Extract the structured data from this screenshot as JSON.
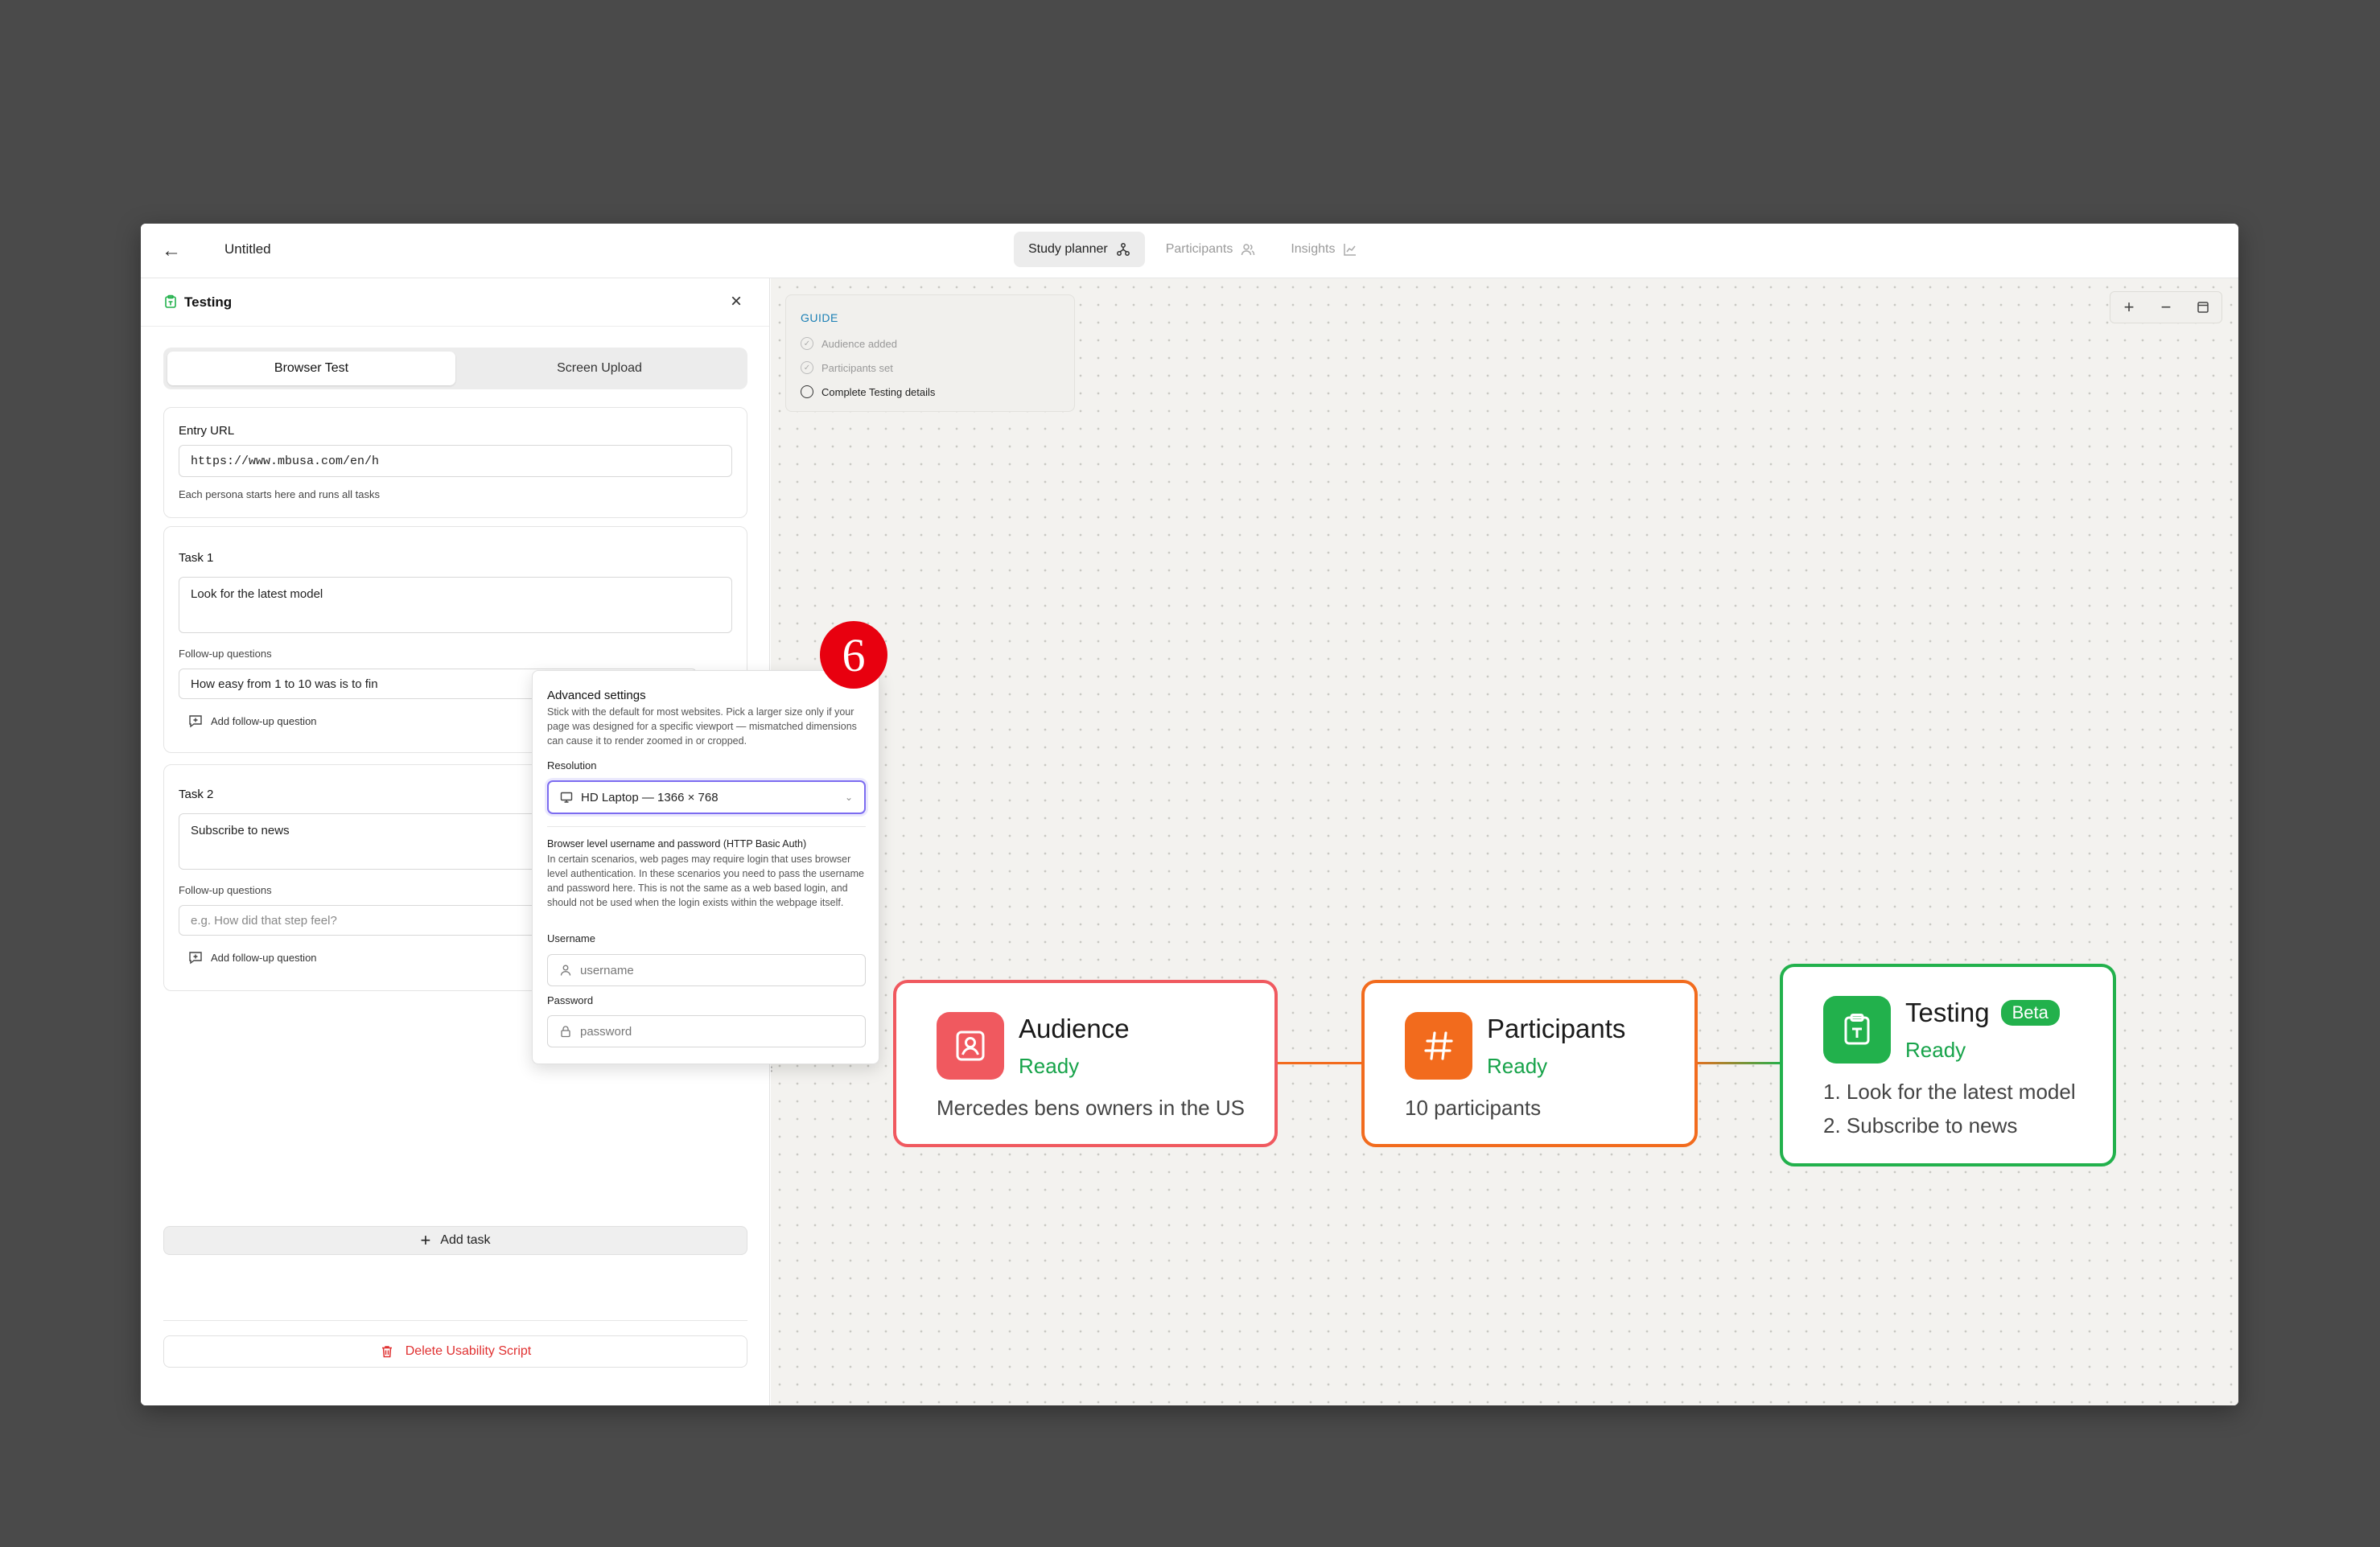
{
  "topbar": {
    "doc_title": "Untitled",
    "tabs": [
      {
        "label": "Study planner",
        "active": true
      },
      {
        "label": "Participants",
        "active": false
      },
      {
        "label": "Insights",
        "active": false
      }
    ]
  },
  "panel": {
    "title": "Testing",
    "segments": [
      {
        "label": "Browser Test",
        "active": true
      },
      {
        "label": "Screen Upload",
        "active": false
      }
    ],
    "entry": {
      "label": "Entry URL",
      "value": "https://www.mbusa.com/en/h",
      "hint": "Each persona starts here and runs all tasks"
    },
    "tasks": [
      {
        "label": "Task 1",
        "text": "Look for the latest model",
        "followup_label": "Follow-up questions",
        "followup_value": "How easy from 1 to 10 was is to fin",
        "followup_placeholder": "",
        "add_label": "Add follow-up question"
      },
      {
        "label": "Task 2",
        "text": "Subscribe to news",
        "followup_label": "Follow-up questions",
        "followup_value": "",
        "followup_placeholder": "e.g. How did that step feel?",
        "add_label": "Add follow-up question"
      }
    ],
    "add_task_label": "Add task",
    "delete_label": "Delete Usability Script"
  },
  "advanced": {
    "title": "Advanced settings",
    "desc": "Stick with the default for most websites. Pick a larger size only if your page was designed for a specific viewport — mismatched dimensions can cause it to render zoomed in or cropped.",
    "resolution_label": "Resolution",
    "resolution_value": "HD Laptop — 1366 × 768",
    "auth_title": "Browser level username and password (HTTP Basic Auth)",
    "auth_desc": "In certain scenarios, web pages may require login that uses browser level authentication. In these scenarios you need to pass the username and password here. This is not the same as a web based login, and should not be used when the login exists within the webpage itself.",
    "username_label": "Username",
    "username_placeholder": "username",
    "password_label": "Password",
    "password_placeholder": "password"
  },
  "step_badge": "6",
  "guide": {
    "title": "GUIDE",
    "items": [
      {
        "label": "Audience added",
        "done": true
      },
      {
        "label": "Participants set",
        "done": true
      },
      {
        "label": "Complete Testing details",
        "done": false
      }
    ]
  },
  "zoom": {
    "plus": "+",
    "minus": "−"
  },
  "nodes": {
    "audience": {
      "title": "Audience",
      "status": "Ready",
      "desc": "Mercedes bens owners in the US",
      "color": "#f0595f"
    },
    "participants": {
      "title": "Participants",
      "status": "Ready",
      "desc": "10 participants",
      "color": "#f26b1d"
    },
    "testing": {
      "title": "Testing",
      "badge": "Beta",
      "status": "Ready",
      "lines": [
        "1. Look for the latest model",
        "2. Subscribe to news"
      ],
      "color": "#22b14c"
    }
  }
}
